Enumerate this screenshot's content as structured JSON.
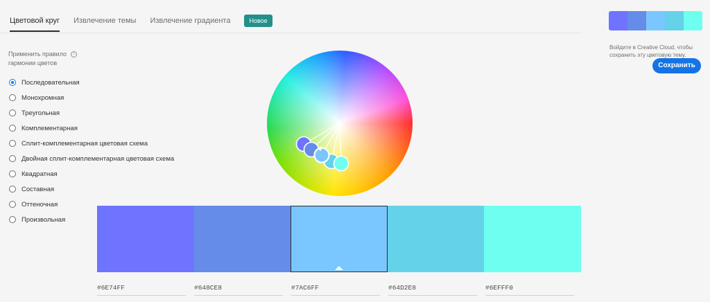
{
  "tabs": [
    {
      "label": "Цветовой круг",
      "active": true
    },
    {
      "label": "Извлечение темы",
      "active": false
    },
    {
      "label": "Извлечение градиента",
      "active": false
    }
  ],
  "new_badge": "Новое",
  "harmony": {
    "label": "Применить правило гармонии цветов",
    "info_icon": "info-icon",
    "options": [
      {
        "label": "Последовательная",
        "checked": true
      },
      {
        "label": "Монохромная",
        "checked": false
      },
      {
        "label": "Треугольная",
        "checked": false
      },
      {
        "label": "Комплементарная",
        "checked": false
      },
      {
        "label": "Сплит-комплементарная цветовая схема",
        "checked": false
      },
      {
        "label": "Двойная сплит-комплементарная цветовая схема",
        "checked": false
      },
      {
        "label": "Квадратная",
        "checked": false
      },
      {
        "label": "Составная",
        "checked": false
      },
      {
        "label": "Оттеночная",
        "checked": false
      },
      {
        "label": "Произвольная",
        "checked": false
      }
    ]
  },
  "swatches": [
    {
      "hex": "#6E74FF",
      "selected": false
    },
    {
      "hex": "#648CE8",
      "selected": false
    },
    {
      "hex": "#7AC6FF",
      "selected": true
    },
    {
      "hex": "#64D2E8",
      "selected": false
    },
    {
      "hex": "#6EFFF0",
      "selected": false
    }
  ],
  "sidebar": {
    "signin_text": "Войдите в Creative Cloud, чтобы сохранить эту цветовую тему.",
    "save_label": "Сохранить"
  },
  "colors": {
    "accent": "#1473e6",
    "badge": "#23908a"
  }
}
